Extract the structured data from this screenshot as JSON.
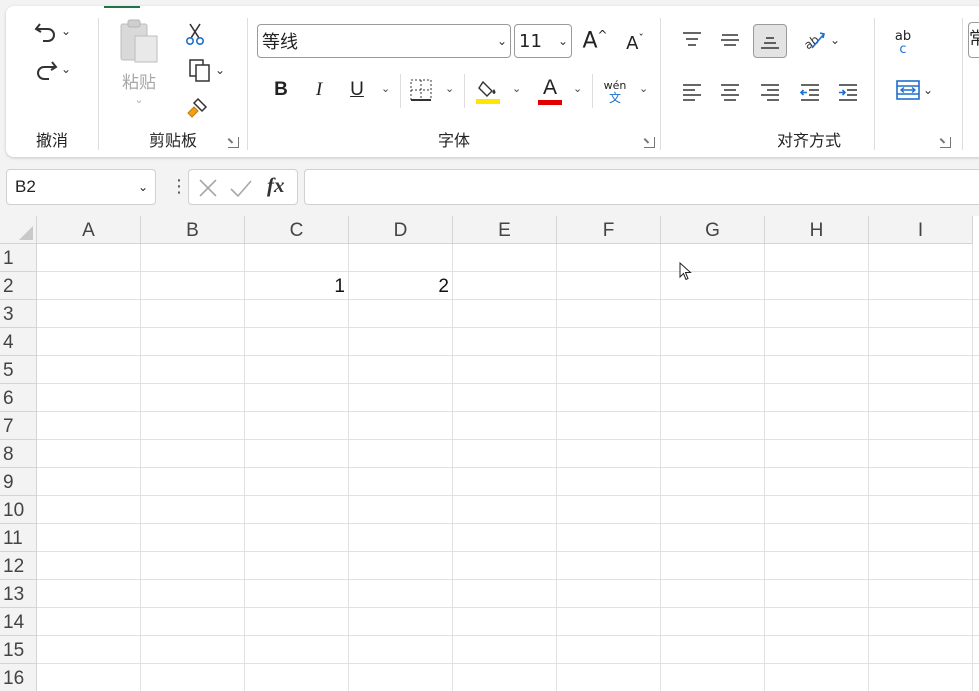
{
  "ribbon": {
    "undo_group_label": "撤消",
    "clipboard": {
      "label": "剪贴板",
      "paste_label": "粘贴"
    },
    "font": {
      "label": "字体",
      "font_name": "等线",
      "font_size": "11",
      "bold": "B",
      "italic": "I",
      "underline": "U",
      "font_color_glyph": "A",
      "fill_highlight_color": "#ffe600",
      "font_color_red": "#e00000",
      "phonetic_top": "wén",
      "phonetic_bottom": "文"
    },
    "alignment": {
      "label": "对齐方式"
    },
    "wrap_glyph_top": "ab",
    "wrap_glyph_bottom": "c",
    "partial_right_text": "常"
  },
  "formula_bar": {
    "name_box": "B2",
    "fx": "fx",
    "formula": ""
  },
  "sheet": {
    "columns": [
      "A",
      "B",
      "C",
      "D",
      "E",
      "F",
      "G",
      "H",
      "I"
    ],
    "rows": [
      "1",
      "2",
      "3",
      "4",
      "5",
      "6",
      "7",
      "8",
      "9",
      "10",
      "11",
      "12",
      "13",
      "14",
      "15",
      "16"
    ],
    "cells": {
      "C2": "1",
      "D2": "2"
    }
  }
}
